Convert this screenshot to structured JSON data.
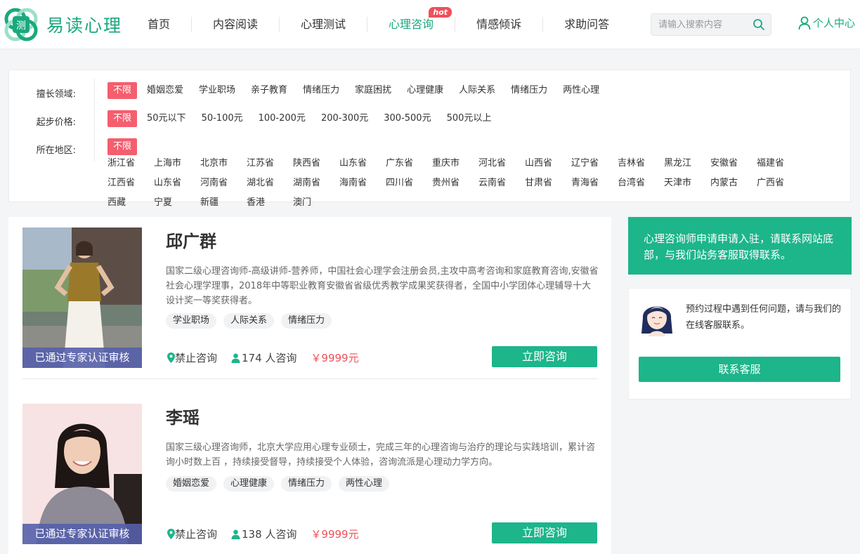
{
  "brand": {
    "name": "易读心理",
    "mark_char": "测",
    "accent": "#1aa97d"
  },
  "nav": {
    "items": [
      {
        "label": "首页"
      },
      {
        "label": "内容阅读"
      },
      {
        "label": "心理测试"
      },
      {
        "label": "心理咨询",
        "badge": "hot"
      },
      {
        "label": "情感倾诉"
      },
      {
        "label": "求助问答"
      }
    ],
    "active_index": 3
  },
  "search": {
    "placeholder": "请输入搜索内容",
    "icon": "search-icon"
  },
  "user": {
    "label": "个人中心",
    "icon": "user-icon"
  },
  "filters": {
    "field": {
      "label": "擅长领域:",
      "options": [
        "不限",
        "婚姻恋爱",
        "学业职场",
        "亲子教育",
        "情绪压力",
        "家庭困扰",
        "心理健康",
        "人际关系",
        "情绪压力",
        "两性心理"
      ]
    },
    "price": {
      "label": "起步价格:",
      "options": [
        "不限",
        "50元以下",
        "50-100元",
        "100-200元",
        "200-300元",
        "300-500元",
        "500元以上"
      ]
    },
    "region": {
      "label": "所在地区:",
      "options": [
        "不限",
        "浙江省",
        "上海市",
        "北京市",
        "江苏省",
        "陕西省",
        "山东省",
        "广东省",
        "重庆市",
        "河北省",
        "山西省",
        "辽宁省",
        "吉林省",
        "黑龙江",
        "安徽省",
        "福建省",
        "江西省",
        "山东省",
        "河南省",
        "湖北省",
        "湖南省",
        "海南省",
        "四川省",
        "贵州省",
        "云南省",
        "甘肃省",
        "青海省",
        "台湾省",
        "天津市",
        "内蒙古",
        "广西省",
        "西藏",
        "宁夏",
        "新疆",
        "香港",
        "澳门"
      ]
    }
  },
  "counselors": [
    {
      "name": "邱广群",
      "desc": "国家二级心理咨询师-高级讲师-营养师，中国社会心理学会注册会员,主攻中高考咨询和家庭教育咨询,安徽省社会心理学理事，2018年中等职业教育安徽省省级优秀教学成果奖获得者，全国中小学团体心理辅导十大设计奖一等奖获得者。",
      "tags": [
        "学业职场",
        "人际关系",
        "情绪压力"
      ],
      "verified": "已通过专家认证审核",
      "location": "禁止咨询",
      "consults": "174 人咨询",
      "price": "￥9999元",
      "button": "立即咨询"
    },
    {
      "name": "李瑶",
      "desc": "国家三级心理咨询师，北京大学应用心理专业硕士，完成三年的心理咨询与治疗的理论与实践培训，累计咨询小时数上百 ，持续接受督导，持续接受个人体验，咨询流派是心理动力学方向。",
      "tags": [
        "婚姻恋爱",
        "心理健康",
        "情绪压力",
        "两性心理"
      ],
      "verified": "已通过专家认证审核",
      "location": "禁止咨询",
      "consults": "138 人咨询",
      "price": "￥9999元",
      "button": "立即咨询"
    }
  ],
  "side": {
    "apply_text": "心理咨询师申请申请入驻，请联系网站底部，与我们站务客服取得联系。",
    "service_text": "预约过程中遇到任何问题，请与我们的在线客服联系。",
    "service_button": "联系客服"
  }
}
